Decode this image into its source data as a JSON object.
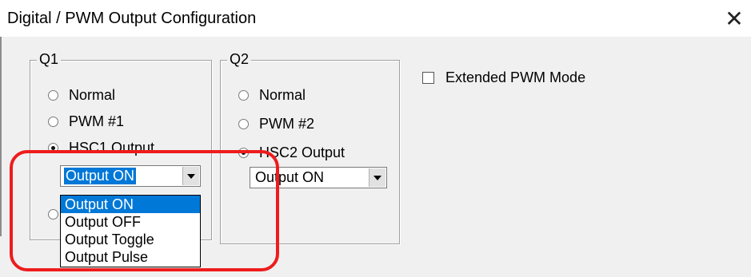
{
  "window": {
    "title": "Digital / PWM Output Configuration",
    "close_glyph": "✕"
  },
  "q1": {
    "label": "Q1",
    "options": [
      {
        "label": "Normal",
        "selected": false
      },
      {
        "label": "PWM #1",
        "selected": false
      },
      {
        "label": "HSC1 Output",
        "selected": true
      }
    ],
    "combo_value": "Output ON",
    "dropdown_options": [
      "Output ON",
      "Output OFF",
      "Output Toggle",
      "Output Pulse"
    ],
    "dropdown_highlighted": "Output ON"
  },
  "q2": {
    "label": "Q2",
    "options": [
      {
        "label": "Normal",
        "selected": false
      },
      {
        "label": "PWM #2",
        "selected": false
      },
      {
        "label": "HSC2 Output",
        "selected": true
      }
    ],
    "combo_value": "Output ON"
  },
  "extended_pwm": {
    "label": "Extended PWM Mode",
    "checked": false
  },
  "annotation": {
    "outline_color": "#ee1c1c"
  },
  "colors": {
    "selection": "#0078d7",
    "dialog_bg": "#f0f0f0"
  }
}
